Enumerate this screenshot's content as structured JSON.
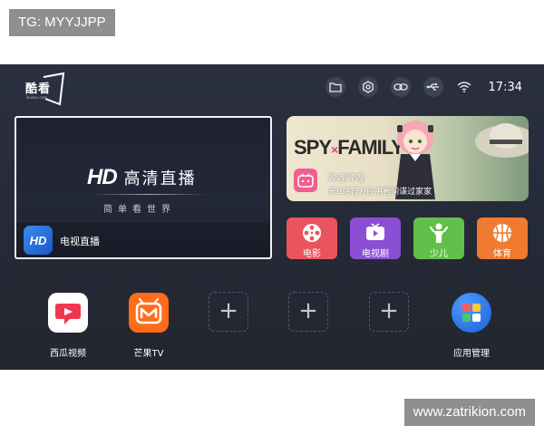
{
  "watermarks": {
    "top_left": "TG: MYYJJPP",
    "bottom_right": "www.zatrikion.com"
  },
  "header": {
    "logo_text": "酷看",
    "logo_subtext": "ikukan.com",
    "status_icons": [
      "folder-icon",
      "settings-icon",
      "link-icon",
      "usb-icon",
      "wifi-icon"
    ],
    "time": "17:34"
  },
  "live_tile": {
    "hd_logo": "HD",
    "title": "高清直播",
    "subtitle": "简单看世界",
    "icon_text": "HD",
    "label": "电视直播"
  },
  "banner": {
    "title_left": "SPY",
    "title_x": "×",
    "title_right": "FAMILY",
    "app_name": "哔哩哔哩",
    "description": "来B站官方应用看间谍过家家"
  },
  "categories": [
    {
      "label": "电影",
      "icon": "film-reel-icon",
      "color": "#e9545f"
    },
    {
      "label": "电视剧",
      "icon": "tv-icon",
      "color": "#8b4fd4"
    },
    {
      "label": "少儿",
      "icon": "child-icon",
      "color": "#62c04a"
    },
    {
      "label": "体育",
      "icon": "basketball-icon",
      "color": "#f07a2f"
    }
  ],
  "apps": [
    {
      "label": "西瓜视频",
      "icon": "xigua-icon"
    },
    {
      "label": "芒果TV",
      "icon": "mango-tv-icon"
    },
    {
      "label": "",
      "icon": "plus-icon"
    },
    {
      "label": "",
      "icon": "plus-icon"
    },
    {
      "label": "",
      "icon": "plus-icon"
    },
    {
      "label": "应用管理",
      "icon": "app-manager-icon"
    }
  ],
  "plus_symbol": "+"
}
